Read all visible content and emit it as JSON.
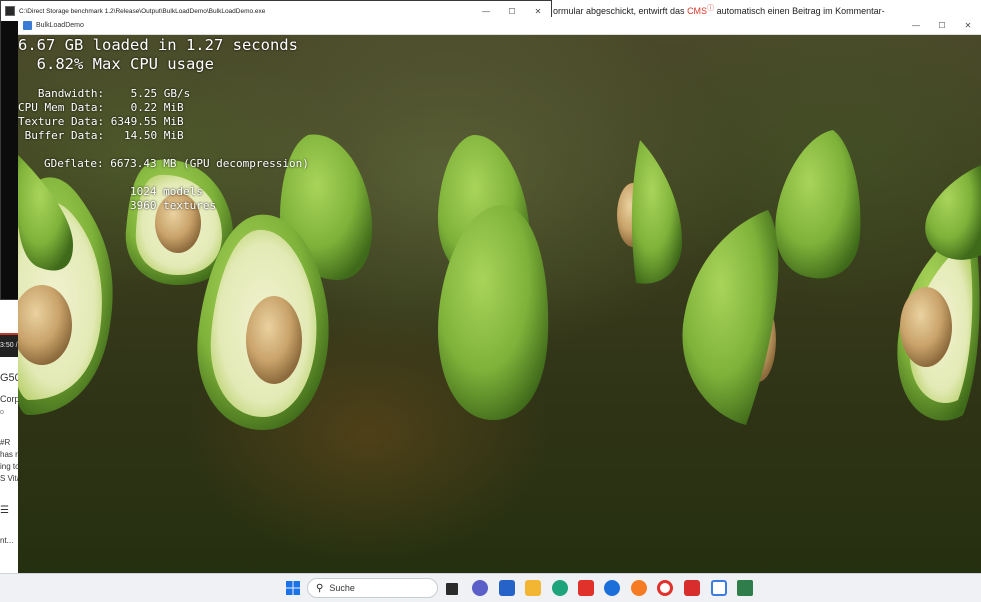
{
  "console": {
    "title": "C:\\Direct Storage benchmark 1.2\\Release\\Output\\BulkLoadDemo\\BulkLoadDemo.exe",
    "minimize": "—",
    "maximize": "☐",
    "close": "✕"
  },
  "browser": {
    "text_before": "ormular abgeschickt, entwirft das ",
    "cms": "CMS",
    "info_glyph": "ⓘ",
    "text_after": " automatisch einen Beitrag im Kommentar-"
  },
  "left_strip": {
    "time": "3:50 /",
    "t1": "G50",
    "t2": "Corp",
    "t3": "o",
    "t4": "#R",
    "t5": "has r",
    "t6": "ing to",
    "t7": "S Vita",
    "t8": "nt..."
  },
  "demo": {
    "title": "BulkLoadDemo",
    "minimize": "—",
    "maximize": "☐",
    "close": "✕"
  },
  "stats": {
    "line1": "6.67 GB loaded in 1.27 seconds",
    "line2": "  6.82% Max CPU usage",
    "bandwidth": "   Bandwidth:    5.25 GB/s",
    "cpu_mem": "CPU Mem Data:    0.22 MiB",
    "texture": "Texture Data: 6349.55 MiB",
    "buffer": " Buffer Data:   14.50 MiB",
    "gdeflate": "GDeflate: 6673.43 MB (GPU decompression)",
    "models": "1024 models",
    "textures": "3960 textures"
  },
  "taskbar": {
    "search_placeholder": "Suche",
    "apps": [
      "start",
      "search",
      "task-view",
      "chat",
      "store",
      "file-explorer",
      "edge",
      "vivaldi",
      "maps-pin",
      "firefox",
      "opera",
      "vivaldi-2",
      "snipping-tool",
      "terminal"
    ]
  },
  "colors": {
    "cms": "#d8382a",
    "avocado_skin": "#7fb23a",
    "avocado_flesh": "#e8edc0",
    "avocado_pit": "#c9a36a",
    "taskbar": "#f0f1f5"
  }
}
